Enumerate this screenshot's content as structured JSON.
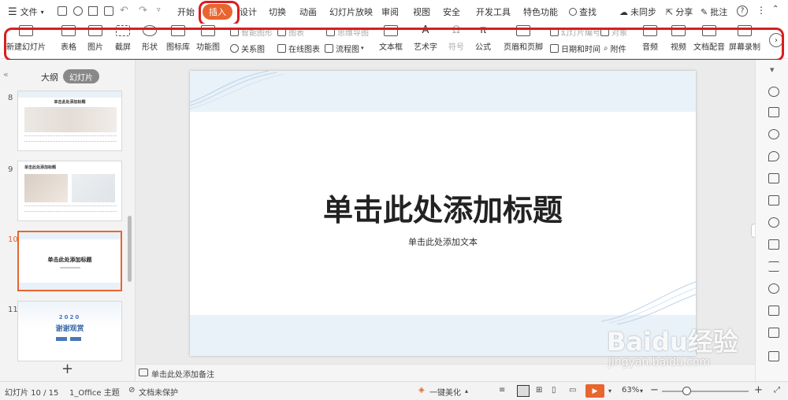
{
  "menubar": {
    "items": [
      "文件",
      "开始",
      "插入",
      "设计",
      "切换",
      "动画",
      "幻灯片放映",
      "审阅",
      "视图",
      "安全",
      "开发工具",
      "特色功能",
      "查找"
    ],
    "right": [
      "未同步",
      "分享",
      "批注"
    ]
  },
  "ribbon": {
    "large": [
      "新建幻灯片",
      "表格",
      "图片",
      "截屏",
      "形状",
      "图标库",
      "功能图",
      "文本框",
      "艺术字",
      "符号",
      "公式",
      "页眉和页脚",
      "音频",
      "视频",
      "文档配音",
      "屏幕录制"
    ],
    "top_row": [
      "智能图形",
      "图表",
      "思维导图",
      "幻灯片编号",
      "对象"
    ],
    "bottom_row": [
      "关系图",
      "在线图表",
      "流程图",
      "日期和时间",
      "附件"
    ]
  },
  "panel": {
    "tabs": [
      "大纲",
      "幻灯片"
    ],
    "thumbnails": [
      {
        "number": "8",
        "title": "单击此处添加标题"
      },
      {
        "number": "9",
        "title": "单击此处添加标题"
      },
      {
        "number": "10",
        "title": "单击此处添加标题"
      },
      {
        "number": "11",
        "year": "2020",
        "title": "谢谢观赏"
      }
    ]
  },
  "slide": {
    "title": "单击此处添加标题",
    "subtitle": "单击此处添加文本"
  },
  "notes": {
    "placeholder": "单击此处添加备注"
  },
  "statusbar": {
    "slide_info": "幻灯片 10 / 15",
    "theme": "1_Office 主题",
    "protection": "文档未保护",
    "beautify": "一键美化",
    "zoom": "63%"
  },
  "watermark": {
    "logo": "Baidu经验",
    "url": "jingyan.baidu.com"
  },
  "colors": {
    "accent": "#e8652f",
    "annotation": "#d91e1e",
    "play": "#e8652f"
  }
}
